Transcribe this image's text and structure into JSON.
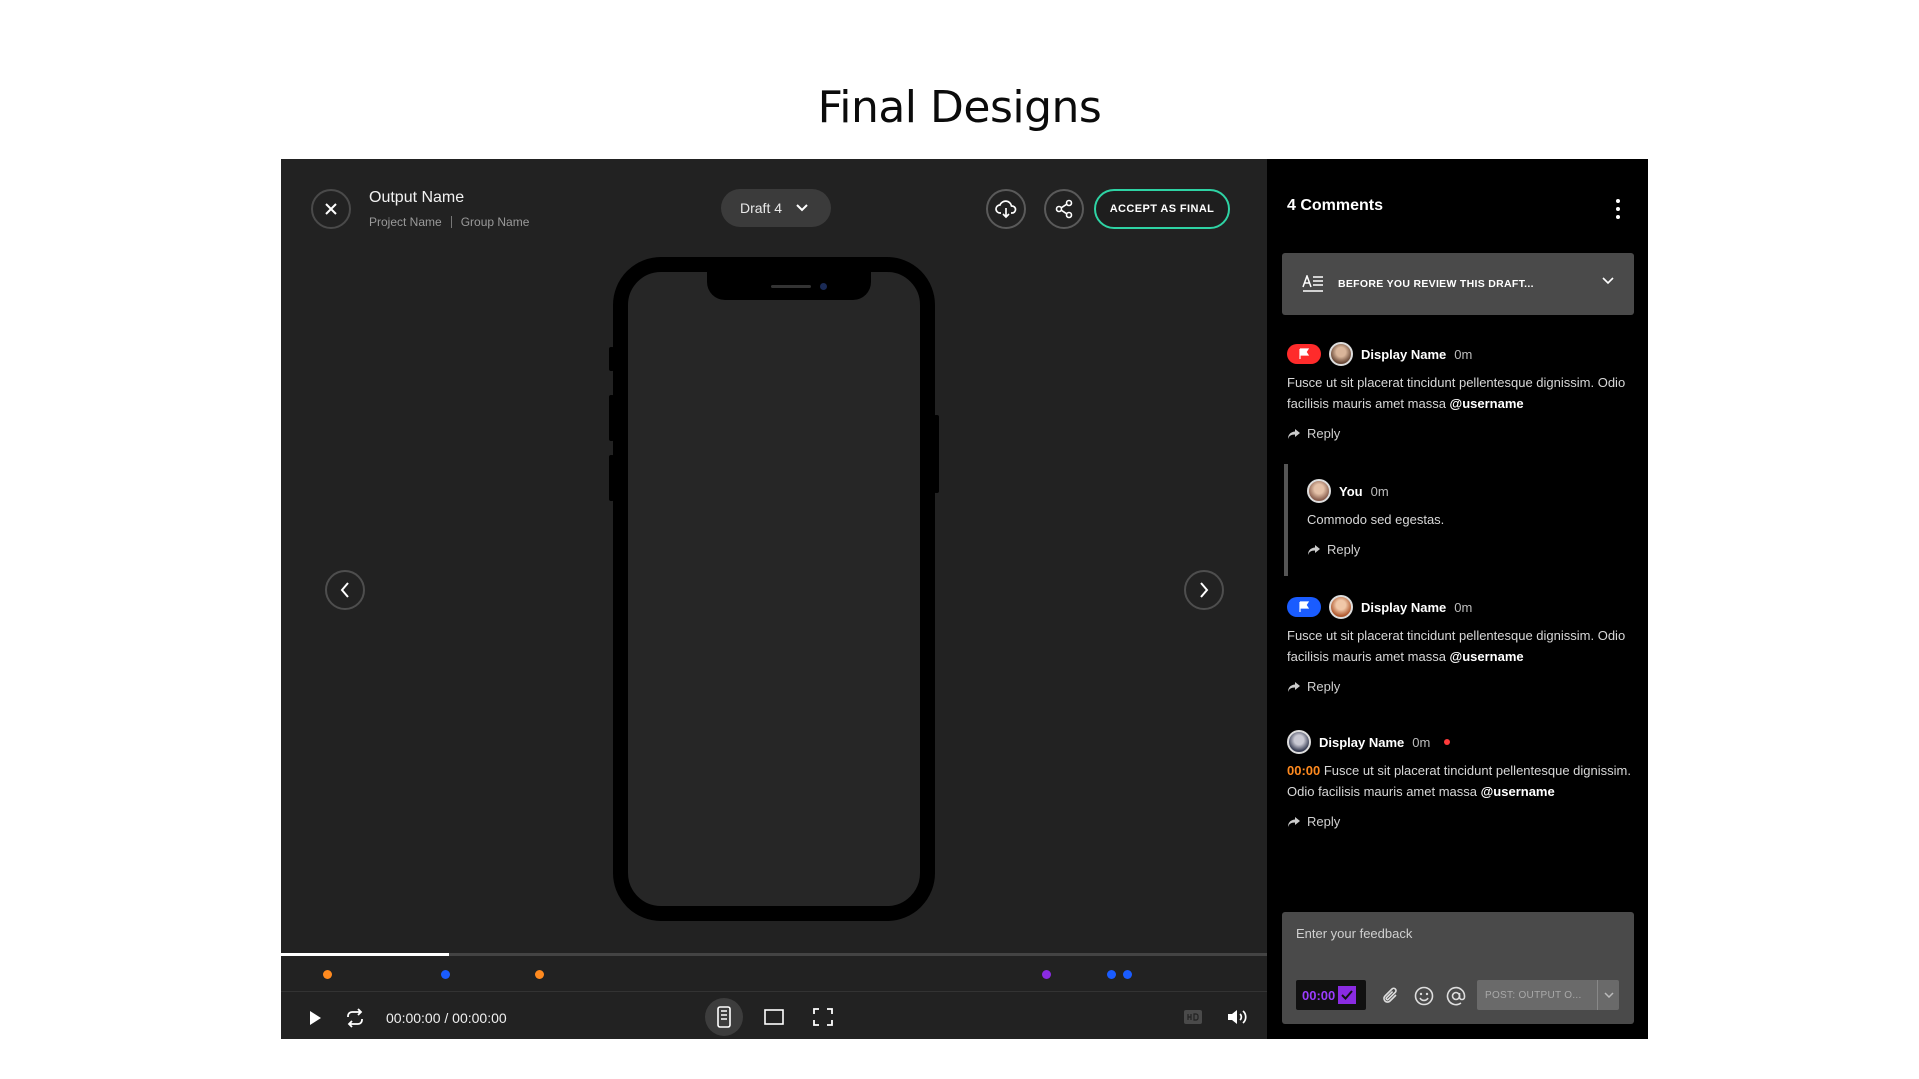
{
  "page": {
    "title": "Final Designs"
  },
  "header": {
    "output_name": "Output Name",
    "project_name": "Project Name",
    "group_name": "Group Name",
    "draft_label": "Draft 4",
    "accept_label": "ACCEPT AS FINAL"
  },
  "player": {
    "time": "00:00:00 / 00:00:00",
    "progress": 0.17,
    "markers": [
      {
        "pos": 0.047,
        "color": "#ff8a1f"
      },
      {
        "pos": 0.167,
        "color": "#1a5cff"
      },
      {
        "pos": 0.262,
        "color": "#ff8a1f"
      },
      {
        "pos": 0.776,
        "color": "#8a2be2"
      },
      {
        "pos": 0.842,
        "color": "#1a5cff"
      },
      {
        "pos": 0.859,
        "color": "#1a5cff"
      }
    ]
  },
  "comments_panel": {
    "title": "4 Comments",
    "review_label": "BEFORE YOU REVIEW THIS DRAFT...",
    "reply_label": "Reply",
    "comments": [
      {
        "name": "Display Name",
        "time": "0m",
        "flag_color": "#ff2b2b",
        "text": "Fusce ut sit placerat tincidunt pellentesque dignissim. Odio facilisis mauris amet massa ",
        "mention": "@username"
      },
      {
        "name": "You",
        "time": "0m",
        "text": "Commodo sed egestas."
      },
      {
        "name": "Display Name",
        "time": "0m",
        "flag_color": "#1a5cff",
        "text": "Fusce ut sit placerat tincidunt pellentesque dignissim. Odio facilisis mauris amet massa ",
        "mention": "@username"
      },
      {
        "name": "Display Name",
        "time": "0m",
        "timestamp": "00:00",
        "text": " Fusce ut sit placerat tincidunt pellentesque dignissim. Odio facilisis mauris amet massa ",
        "mention": "@username"
      }
    ],
    "feedback": {
      "placeholder": "Enter your feedback",
      "timestamp": "00:00",
      "post_label": "POST: OUTPUT O..."
    }
  },
  "colors": {
    "accent": "#2ed3a4",
    "timestamp": "#ff8a1f",
    "chip": "#9b3cff"
  }
}
